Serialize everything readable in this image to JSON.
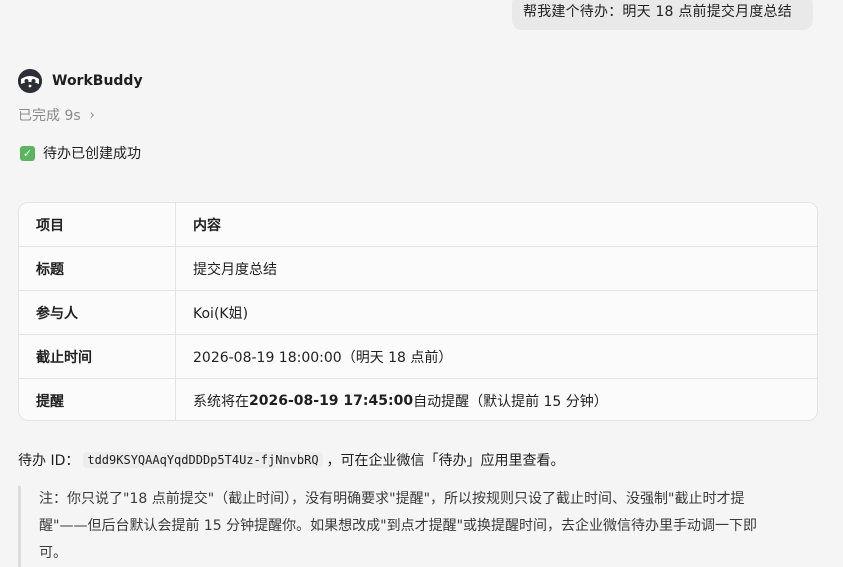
{
  "user_message": "帮我建个待办：明天 18 点前提交月度总结",
  "bot": {
    "name": "WorkBuddy",
    "avatar_icon": "raccoon-avatar-icon",
    "status_text": "已完成 9s",
    "status_chevron": "›"
  },
  "result": {
    "check_icon": "✓",
    "message": "待办已创建成功"
  },
  "table": {
    "headers": [
      "项目",
      "内容"
    ],
    "rows": [
      {
        "key": "标题",
        "value": "提交月度总结"
      },
      {
        "key": "参与人",
        "value": "Koi(K姐)"
      },
      {
        "key": "截止时间",
        "value": "2026-08-19 18:00:00（明天 18 点前）"
      },
      {
        "key": "提醒",
        "value_pre": "系统将在 ",
        "value_bold": "2026-08-19 17:45:00",
        "value_post": " 自动提醒（默认提前 15 分钟）"
      }
    ]
  },
  "todo_id": {
    "label": "待办 ID：",
    "code": "tdd9KSYQAAqYqdDDDp5T4Uz-fjNnvbRQ",
    "suffix": "，可在企业微信「待办」应用里查看。"
  },
  "note": {
    "lines": [
      "注：你只说了\"18 点前提交\"（截止时间），没有明确要求\"提醒\"，所以按规则只设了截止时间、没强制\"截止时才提",
      "醒\"——但后台默认会提前 15 分钟提醒你。如果想改成\"到点才提醒\"或换提醒时间，去企业微信待办里手动调一下即",
      "可。"
    ]
  },
  "colors": {
    "background": "#f5f5f5",
    "bubble": "#e9e9e9",
    "check_green": "#5ab55e",
    "muted_text": "#8a8a8a"
  }
}
